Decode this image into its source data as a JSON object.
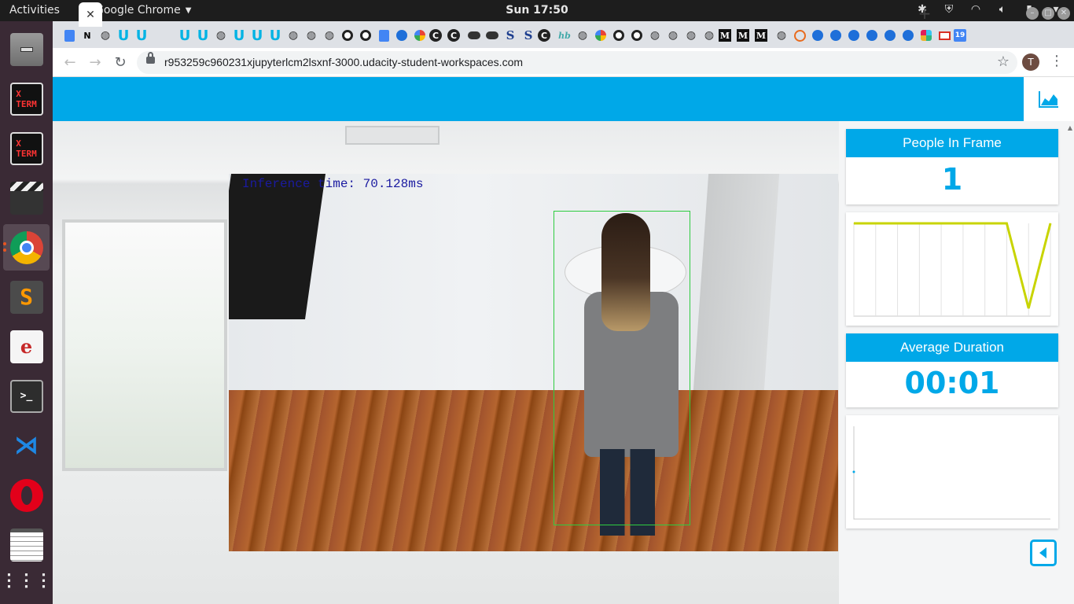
{
  "topbar": {
    "activities": "Activities",
    "app_name": "Google Chrome",
    "clock": "Sun 17:50"
  },
  "browser": {
    "url": "r953259c960231xjupyterlcm2lsxnf-3000.udacity-student-workspaces.com",
    "profile_initial": "T",
    "calendar_favicon": "19",
    "tabs": [
      "doc",
      "N",
      "gh",
      "u",
      "u",
      "active",
      "u",
      "u",
      "gh",
      "u",
      "u",
      "u",
      "gh",
      "gh",
      "gh",
      "circle",
      "circle",
      "doc",
      "gear",
      "g",
      "c",
      "c",
      "eye",
      "eye",
      "s",
      "s",
      "c",
      "hb",
      "gh",
      "g",
      "circle",
      "circle",
      "gh",
      "gh",
      "gh",
      "gh",
      "m",
      "m",
      "m",
      "gh",
      "ring",
      "gear",
      "gear",
      "gear",
      "gear",
      "gear",
      "gear",
      "slack",
      "mail",
      "cal"
    ]
  },
  "app": {
    "inference_text": "Inference time: 70.128ms",
    "people_title": "People In Frame",
    "people_value": "1",
    "duration_title": "Average Duration",
    "duration_value": "00:01",
    "accent_color": "#00a8e8",
    "bbox_color": "#2ecc40"
  },
  "chart_data": [
    {
      "type": "line",
      "title": "",
      "xlabel": "",
      "ylabel": "",
      "x": [
        1,
        2,
        3,
        4,
        5,
        6,
        7,
        8,
        9,
        10
      ],
      "series": [
        {
          "values": [
            1,
            1,
            1,
            1,
            1,
            1,
            1,
            1,
            0,
            1
          ]
        }
      ],
      "ylim": [
        0,
        1
      ],
      "grid": true,
      "color": "#c8d400"
    },
    {
      "type": "line",
      "title": "",
      "xlabel": "",
      "ylabel": "",
      "x": [
        1
      ],
      "series": [
        {
          "values": [
            0
          ]
        }
      ],
      "grid": false,
      "color": "#00a8e8"
    }
  ]
}
